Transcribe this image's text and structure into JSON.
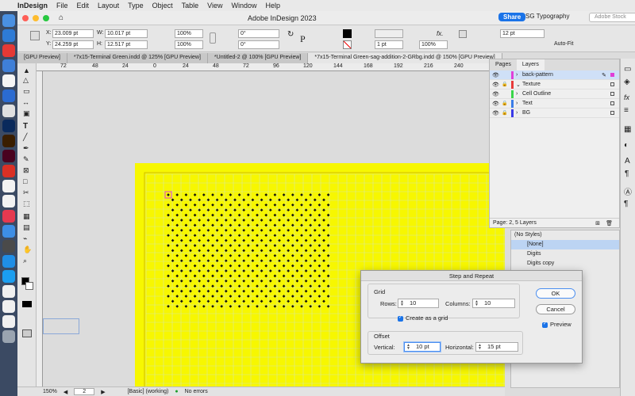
{
  "menubar": {
    "app": "InDesign",
    "items": [
      "File",
      "Edit",
      "Layout",
      "Type",
      "Object",
      "Table",
      "View",
      "Window",
      "Help"
    ]
  },
  "window": {
    "title": "Adobe InDesign 2023",
    "share_label": "Share",
    "workspace": "SG Typography",
    "stock_placeholder": "Adobe Stock"
  },
  "control": {
    "x_label": "X:",
    "x_value": "23.009 pt",
    "y_label": "Y:",
    "y_value": "24.259 pt",
    "w_label": "W:",
    "w_value": "10.017 pt",
    "h_label": "H:",
    "h_value": "12.517 pt",
    "scale_x": "100%",
    "scale_y": "100%",
    "angle1": "0°",
    "angle2": "0°",
    "stroke_weight": "1 pt",
    "opacity": "100%",
    "spacing": "12 pt",
    "autofit": "Auto-Fit"
  },
  "tabs": [
    "[GPU Preview]",
    "*7x15-Terminal Green.indd @ 125% [GPU Preview]",
    "*Untitled-2 @ 100% [GPU Preview]",
    "*7x15-Terminal Green-sag-addition-2-GRbg.indd @ 150% [GPU Preview]"
  ],
  "ruler": [
    "72",
    "48",
    "24",
    "0",
    "24",
    "48",
    "72",
    "96",
    "120",
    "144",
    "168",
    "192",
    "216",
    "240"
  ],
  "status": {
    "zoom": "150%",
    "page": "2",
    "style": "[Basic] (working)",
    "errors": "No errors"
  },
  "layers_panel": {
    "tab_pages": "Pages",
    "tab_layers": "Layers",
    "layers": [
      {
        "name": "back-pattern",
        "color": "#e040d8",
        "selected": true,
        "locked": false,
        "expanded": false
      },
      {
        "name": "Texture",
        "color": "#e83a3a",
        "selected": false,
        "locked": true,
        "expanded": true
      },
      {
        "name": "Cell Outline",
        "color": "#3ad64a",
        "selected": false,
        "locked": false,
        "expanded": false
      },
      {
        "name": "Text",
        "color": "#3a7de8",
        "selected": false,
        "locked": true,
        "expanded": false
      },
      {
        "name": "BG",
        "color": "#3a3ae8",
        "selected": false,
        "locked": true,
        "expanded": false
      }
    ],
    "footer": "Page: 2, 5 Layers"
  },
  "styles_panel": {
    "items": [
      "(No Styles)",
      "[None]",
      "Digits",
      "Digits copy"
    ]
  },
  "dialog": {
    "title": "Step and Repeat",
    "grid_label": "Grid",
    "rows_label": "Rows:",
    "rows_value": "10",
    "columns_label": "Columns:",
    "columns_value": "10",
    "create_grid_label": "Create as a grid",
    "offset_label": "Offset",
    "vertical_label": "Vertical:",
    "vertical_value": "10 pt",
    "horizontal_label": "Horizontal:",
    "horizontal_value": "15 pt",
    "ok_label": "OK",
    "cancel_label": "Cancel",
    "preview_label": "Preview"
  },
  "colors": {
    "page_yellow": "#f7f700",
    "accent_blue": "#1a73e8"
  }
}
